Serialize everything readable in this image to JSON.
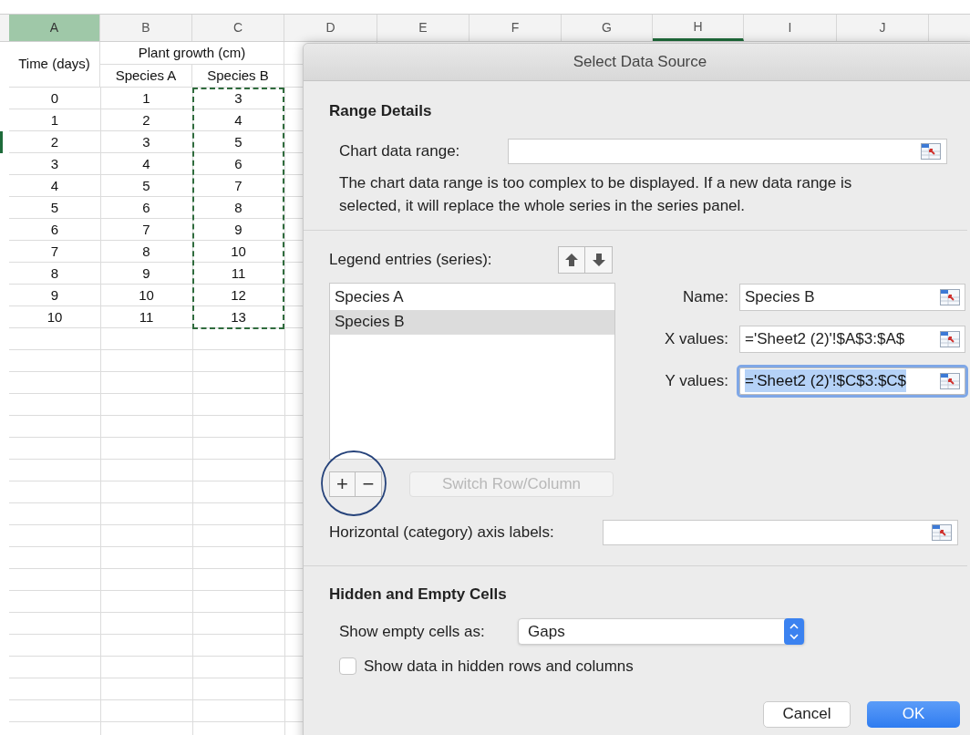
{
  "sheet": {
    "column_headers": [
      {
        "label": "A",
        "selected": true,
        "underlined": false,
        "marquee": false
      },
      {
        "label": "B",
        "selected": false,
        "underlined": false,
        "marquee": false
      },
      {
        "label": "C",
        "selected": false,
        "underlined": false,
        "marquee": true
      },
      {
        "label": "D",
        "selected": false,
        "underlined": false,
        "marquee": false
      },
      {
        "label": "E",
        "selected": false,
        "underlined": false,
        "marquee": false
      },
      {
        "label": "F",
        "selected": false,
        "underlined": false,
        "marquee": false
      },
      {
        "label": "G",
        "selected": false,
        "underlined": false,
        "marquee": false
      },
      {
        "label": "H",
        "selected": false,
        "underlined": true,
        "marquee": false
      },
      {
        "label": "I",
        "selected": false,
        "underlined": false,
        "marquee": false
      },
      {
        "label": "J",
        "selected": false,
        "underlined": false,
        "marquee": false
      }
    ],
    "header_cells": {
      "time": "Time (days)",
      "group": "Plant growth (cm)",
      "species_a": "Species A",
      "species_b": "Species B"
    },
    "rows": [
      {
        "cells": [
          "0",
          "1",
          "3"
        ],
        "selected": false
      },
      {
        "cells": [
          "1",
          "2",
          "4"
        ],
        "selected": false
      },
      {
        "cells": [
          "2",
          "3",
          "5"
        ],
        "selected": true
      },
      {
        "cells": [
          "3",
          "4",
          "6"
        ],
        "selected": false
      },
      {
        "cells": [
          "4",
          "5",
          "7"
        ],
        "selected": false
      },
      {
        "cells": [
          "5",
          "6",
          "8"
        ],
        "selected": false
      },
      {
        "cells": [
          "6",
          "7",
          "9"
        ],
        "selected": false
      },
      {
        "cells": [
          "7",
          "8",
          "10"
        ],
        "selected": false
      },
      {
        "cells": [
          "8",
          "9",
          "11"
        ],
        "selected": false
      },
      {
        "cells": [
          "9",
          "10",
          "12"
        ],
        "selected": false
      },
      {
        "cells": [
          "10",
          "11",
          "13"
        ],
        "selected": false
      }
    ]
  },
  "dialog": {
    "title": "Select Data Source",
    "range_details": {
      "heading": "Range Details",
      "label": "Chart data range:",
      "note": "The chart data range is too complex to be displayed. If a new data range is selected, it will replace the whole series in the series panel."
    },
    "legend": {
      "label": "Legend entries (series):",
      "series": [
        {
          "label": "Species A",
          "selected": false
        },
        {
          "label": "Species B",
          "selected": true
        }
      ],
      "add": "+",
      "remove": "−",
      "switch_button": {
        "label": "Switch Row/Column",
        "disabled": true
      }
    },
    "series_fields": [
      {
        "label": "Name:",
        "value": "Species B",
        "focused": false
      },
      {
        "label": "X values:",
        "value": "='Sheet2 (2)'!$A$3:$A$",
        "focused": false
      },
      {
        "label": "Y values:",
        "value": "='Sheet2 (2)'!$C$3:$C$",
        "focused": true
      }
    ],
    "axis_labels": {
      "label": "Horizontal (category) axis labels:"
    },
    "hidden_empty": {
      "heading": "Hidden and Empty Cells",
      "empty_label": "Show empty cells as:",
      "empty_value": "Gaps",
      "checkbox": {
        "label": "Show data in hidden rows and columns",
        "checked": false
      }
    },
    "buttons": [
      {
        "label": "Cancel",
        "kind": "normal"
      },
      {
        "label": "OK",
        "kind": "default"
      }
    ]
  }
}
